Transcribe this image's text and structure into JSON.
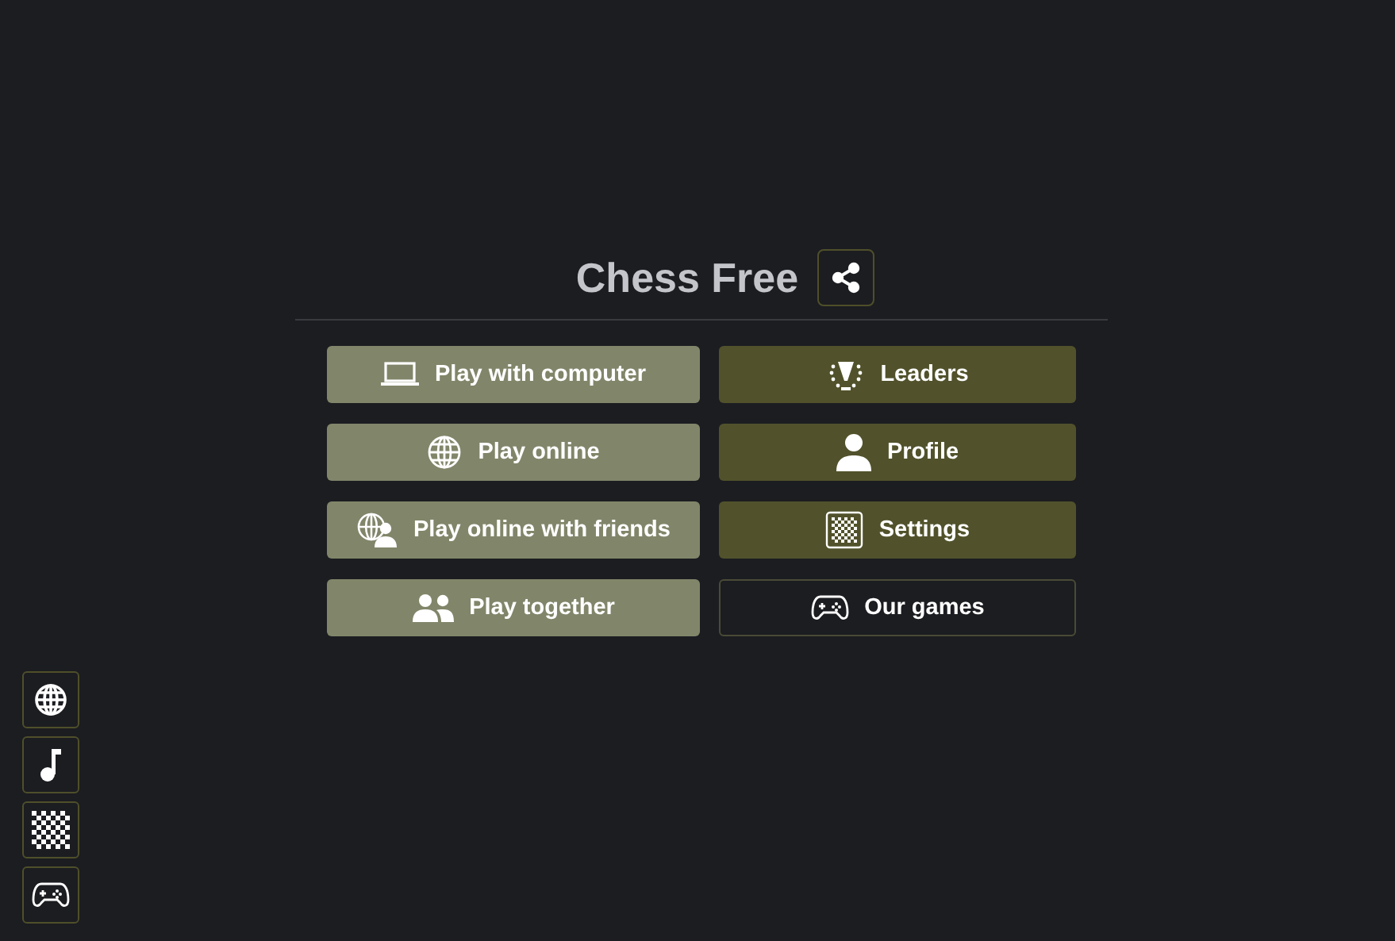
{
  "header": {
    "title": "Chess Free"
  },
  "menu": [
    {
      "label": "Play with computer",
      "kind": "light"
    },
    {
      "label": "Leaders",
      "kind": "dark"
    },
    {
      "label": "Play online",
      "kind": "light"
    },
    {
      "label": "Profile",
      "kind": "dark"
    },
    {
      "label": "Play online with friends",
      "kind": "light"
    },
    {
      "label": "Settings",
      "kind": "dark"
    },
    {
      "label": "Play together",
      "kind": "light"
    },
    {
      "label": "Our games",
      "kind": "outline"
    }
  ]
}
